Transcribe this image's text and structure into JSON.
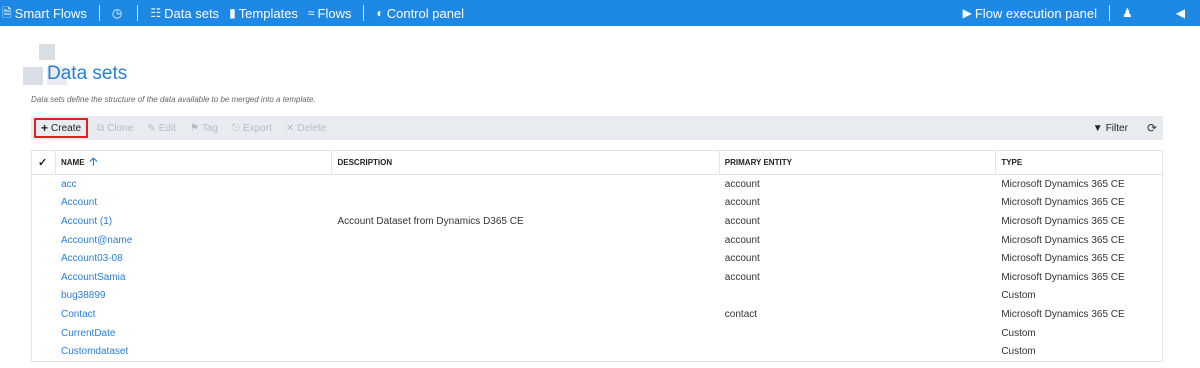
{
  "topbar": {
    "brand": "Smart Flows",
    "nav": [
      {
        "label": "Data sets",
        "icon": "sitemap-icon"
      },
      {
        "label": "Templates",
        "icon": "file-icon"
      },
      {
        "label": "Flows",
        "icon": "waves-icon"
      },
      {
        "label": "Control panel",
        "icon": "gauge-icon"
      }
    ],
    "execution_panel": "Flow execution panel"
  },
  "page": {
    "title": "Data sets",
    "subtitle": "Data sets define the structure of the data available to be merged into a template."
  },
  "toolbar": {
    "create": "Create",
    "clone": "Clone",
    "edit": "Edit",
    "tag": "Tag",
    "export": "Export",
    "delete": "Delete",
    "filter": "Filter"
  },
  "table": {
    "columns": [
      "NAME",
      "DESCRIPTION",
      "PRIMARY ENTITY",
      "TYPE"
    ],
    "sort": {
      "column": "NAME",
      "direction": "ascending"
    },
    "rows": [
      {
        "name": "acc",
        "description": "",
        "entity": "account",
        "type": "Microsoft Dynamics 365 CE"
      },
      {
        "name": "Account",
        "description": "",
        "entity": "account",
        "type": "Microsoft Dynamics 365 CE"
      },
      {
        "name": "Account (1)",
        "description": "Account Dataset from Dynamics D365 CE",
        "entity": "account",
        "type": "Microsoft Dynamics 365 CE"
      },
      {
        "name": "Account@name",
        "description": "",
        "entity": "account",
        "type": "Microsoft Dynamics 365 CE"
      },
      {
        "name": "Account03-08",
        "description": "",
        "entity": "account",
        "type": "Microsoft Dynamics 365 CE"
      },
      {
        "name": "AccountSamia",
        "description": "",
        "entity": "account",
        "type": "Microsoft Dynamics 365 CE"
      },
      {
        "name": "bug38899",
        "description": "",
        "entity": "",
        "type": "Custom"
      },
      {
        "name": "Contact",
        "description": "",
        "entity": "contact",
        "type": "Microsoft Dynamics 365 CE"
      },
      {
        "name": "CurrentDate",
        "description": "",
        "entity": "",
        "type": "Custom"
      },
      {
        "name": "Customdataset",
        "description": "",
        "entity": "",
        "type": "Custom"
      }
    ]
  },
  "colors": {
    "topbar": "#1e88e5",
    "link": "#2a7fd4",
    "highlight": "#e02020",
    "toolbar_bg": "#e8ebef"
  }
}
